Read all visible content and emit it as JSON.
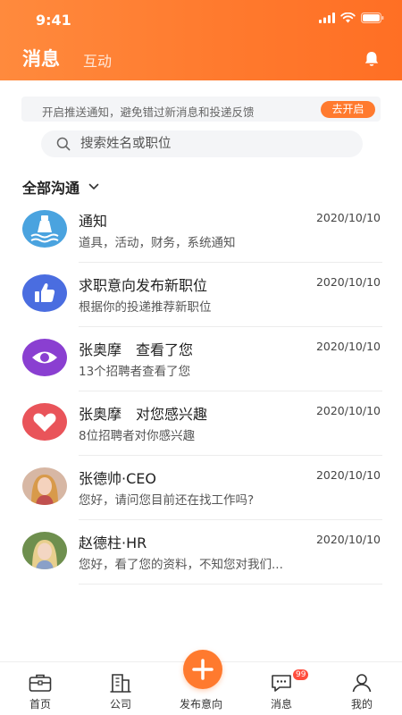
{
  "status_bar": {
    "time": "9:41"
  },
  "header": {
    "tab_active": "消息",
    "tab_inactive": "互动"
  },
  "notice": {
    "text": "开启推送通知，避免错过新消息和投递反馈",
    "button": "去开启"
  },
  "search": {
    "placeholder": "搜索姓名或职位"
  },
  "filter": {
    "label": "全部沟通"
  },
  "messages": [
    {
      "title": "通知",
      "date": "2020/10/10",
      "subtitle": "道具，活动，财务，系统通知",
      "icon": "bottle-icon",
      "color": "#4aa3df"
    },
    {
      "title": "求职意向发布新职位",
      "date": "2020/10/10",
      "subtitle": "根据你的投递推荐新职位",
      "icon": "thumbs-up-icon",
      "color": "#4a6de0"
    },
    {
      "title": "张奥摩　查看了您",
      "date": "2020/10/10",
      "subtitle": "13个招聘者查看了您",
      "icon": "eye-icon",
      "color": "#8a3fd1"
    },
    {
      "title": "张奥摩　对您感兴趣",
      "date": "2020/10/10",
      "subtitle": "8位招聘者对你感兴趣",
      "icon": "heart-icon",
      "color": "#e9545a"
    },
    {
      "title": "张德帅·CEO",
      "date": "2020/10/10",
      "subtitle": "您好，请问您目前还在找工作吗?",
      "icon": "user-avatar-photo"
    },
    {
      "title": "赵德柱·HR",
      "date": "2020/10/10",
      "subtitle": "您好，看了您的资料，不知您对我们...",
      "icon": "user-avatar-photo"
    }
  ],
  "tabbar": {
    "home": "首页",
    "company": "公司",
    "post": "发布意向",
    "messages": "消息",
    "messages_badge": "99",
    "mine": "我的"
  },
  "colors": {
    "accent": "#ff7a2e",
    "badge": "#ff4d3d"
  }
}
